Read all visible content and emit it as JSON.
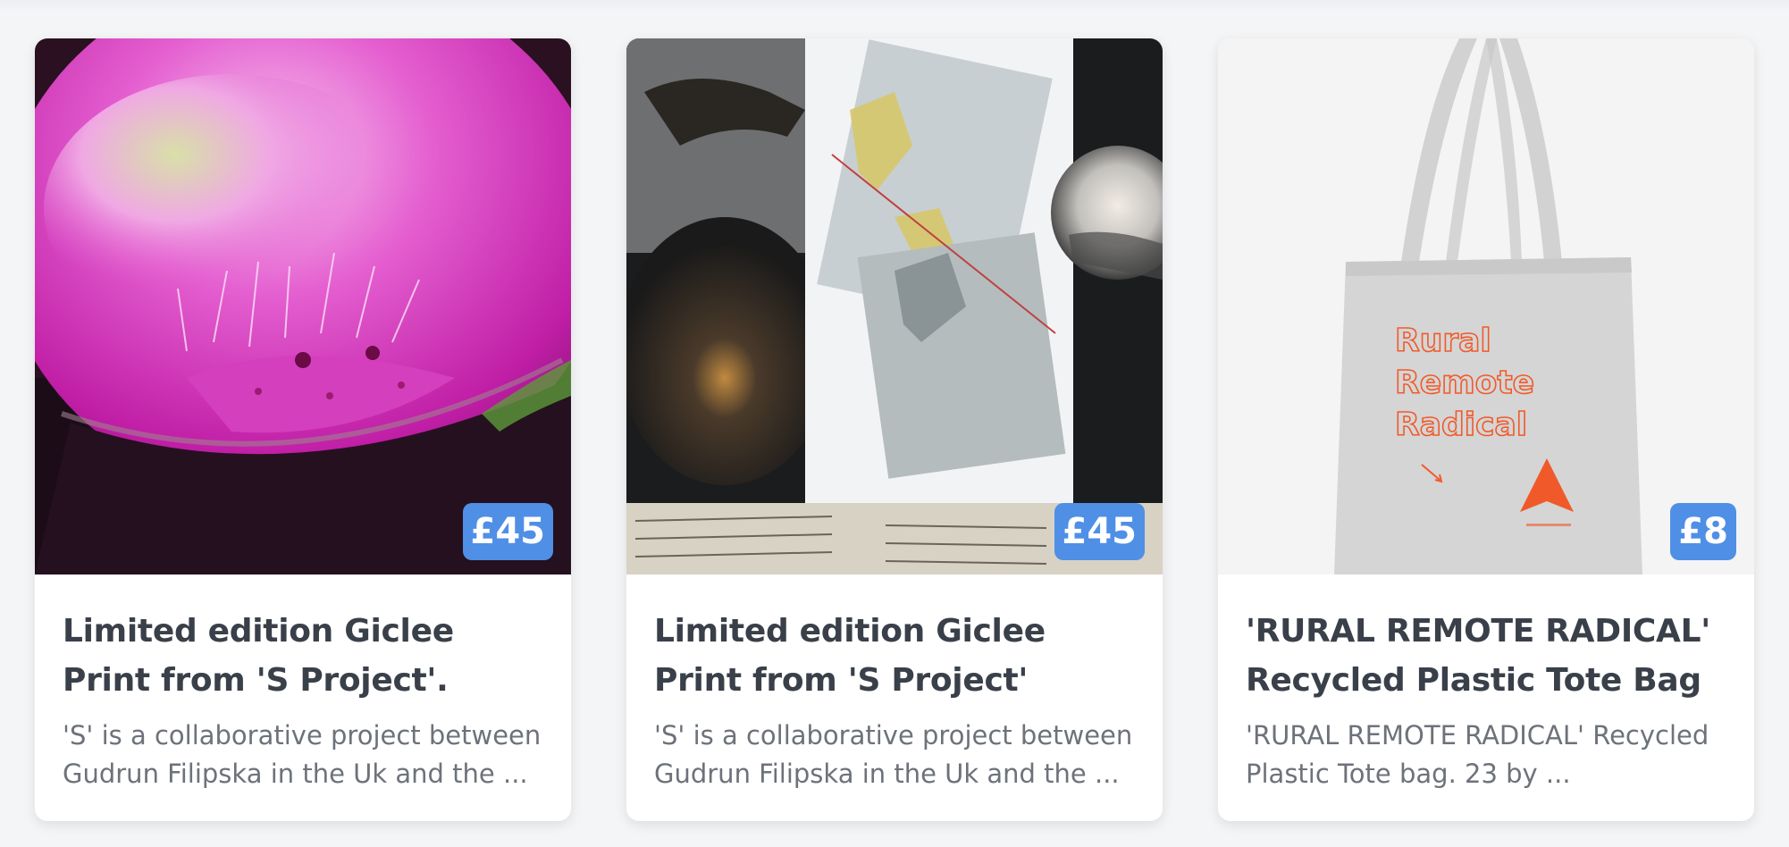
{
  "products": [
    {
      "image_alt": "Pink foxglove flower close-up",
      "price": "£45",
      "title": "Limited edition Giclee Print from 'S Project'.",
      "description": "'S' is a collaborative project between Gudrun Filipska in the Uk and the ..."
    },
    {
      "image_alt": "Collage of nautical charts, glass bowl and lens",
      "price": "£45",
      "title": "Limited edition Giclee Print from 'S Project'",
      "description": "'S' is a collaborative project between Gudrun Filipska in the Uk and the ..."
    },
    {
      "image_alt": "Grey tote bag printed with Rural Remote Radical",
      "price": "£8",
      "title": "'RURAL REMOTE RADICAL' Recycled Plastic Tote Bag",
      "description": "'RURAL REMOTE RADICAL' Recycled Plastic Tote bag. 23 by ...",
      "bag_print": [
        "Rural",
        "Remote",
        "Radical"
      ],
      "brand_color": "#f05a2a"
    }
  ],
  "colors": {
    "badge": "#4f8fe6",
    "title": "#3a4049",
    "description": "#6d727a"
  }
}
